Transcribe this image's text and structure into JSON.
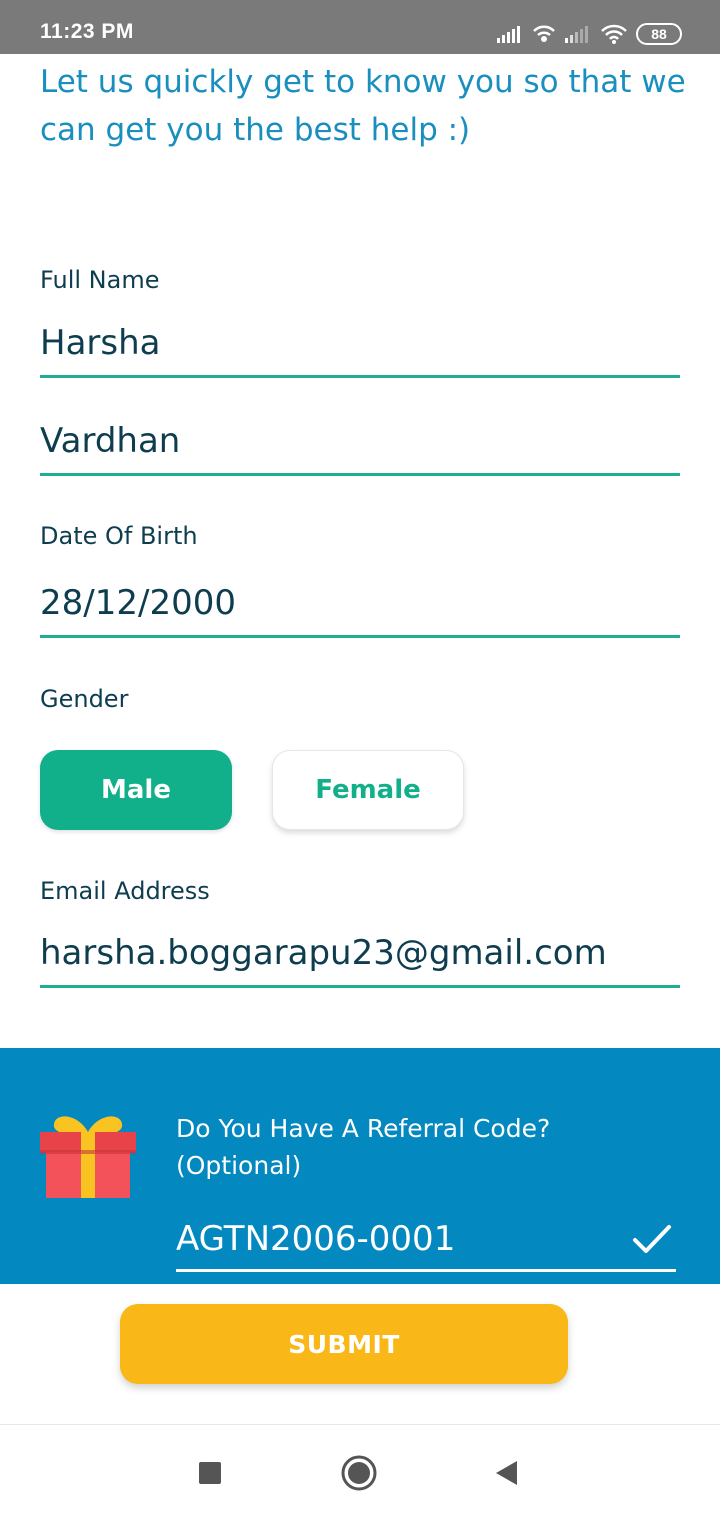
{
  "status_bar": {
    "time": "11:23 PM",
    "battery": "88",
    "icons": [
      "signal-icon",
      "wifi-hotspot-icon",
      "signal-icon",
      "wifi-icon",
      "battery-icon"
    ]
  },
  "intro": {
    "text": "Let us quickly get to know you so that we can get you the best help :)"
  },
  "form": {
    "full_name_label": "Full Name",
    "first_name_value": "Harsha",
    "last_name_value": "Vardhan",
    "dob_label": "Date Of Birth",
    "dob_value": "28/12/2000",
    "gender_label": "Gender",
    "gender_options": [
      "Male",
      "Female"
    ],
    "gender_selected": "Male",
    "email_label": "Email Address",
    "email_value": "harsha.boggarapu23@gmail.com"
  },
  "referral": {
    "title_line1": "Do You Have A Referral Code?",
    "title_line2": "(Optional)",
    "code_value": "AGTN2006-0001",
    "icon": "gift-icon",
    "status_icon": "checkmark-icon"
  },
  "submit": {
    "label": "SUBMIT"
  },
  "colors": {
    "accent_green": "#12b08a",
    "underline_teal": "#1fae94",
    "headline_blue": "#1a8fbf",
    "panel_blue": "#0488c0",
    "submit_yellow": "#f9b718",
    "text_dark": "#0e3d4f"
  },
  "nav_bar": {
    "icons": [
      "recents-square-icon",
      "home-circle-icon",
      "back-triangle-icon"
    ]
  }
}
